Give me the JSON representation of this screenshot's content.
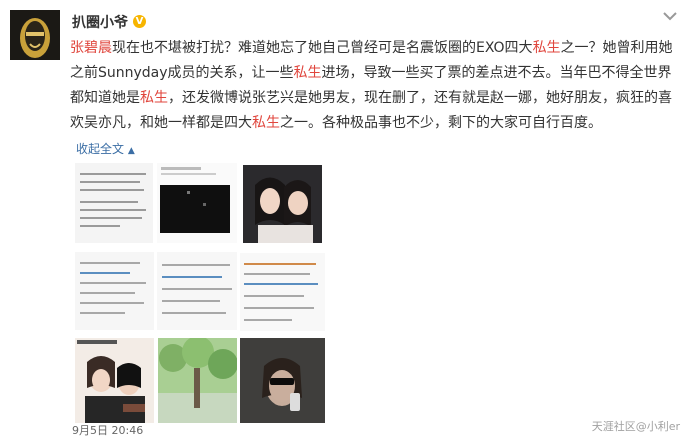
{
  "post": {
    "username": "扒圈小爷",
    "verified_badge": "V",
    "segments": [
      {
        "text": "张碧晨",
        "highlight": true
      },
      {
        "text": "现在也不堪被打扰？难道她忘了她自己曾经可是名震饭圈的EXO四大",
        "highlight": false
      },
      {
        "text": "私生",
        "highlight": true
      },
      {
        "text": "之一？她曾利用她之前Sunnyday成员的关系，让一些",
        "highlight": false
      },
      {
        "text": "私生",
        "highlight": true
      },
      {
        "text": "进场，导致一些买了票的差点进不去。当年巴不得全世界都知道她是",
        "highlight": false
      },
      {
        "text": "私生",
        "highlight": true
      },
      {
        "text": "，还发微博说张艺兴是她男友，现在删了，还有就是赵一娜，她好朋友，疯狂的喜欢吴亦凡，和她一样都是四大",
        "highlight": false
      },
      {
        "text": "私生",
        "highlight": true
      },
      {
        "text": "之一。各种极品事也不少，剩下的大家可自行百度。",
        "highlight": false
      }
    ],
    "collapse_label": "收起全文",
    "collapse_icon": "up-arrow-icon",
    "timestamp": "9月5日 20:46",
    "watermark": "天涯社区@小利er",
    "thumbs_top_right_caption": "",
    "colors": {
      "highlight": "#e0463d",
      "link": "#3b6ea5",
      "badge": "#f7b500",
      "text": "#333333"
    }
  }
}
